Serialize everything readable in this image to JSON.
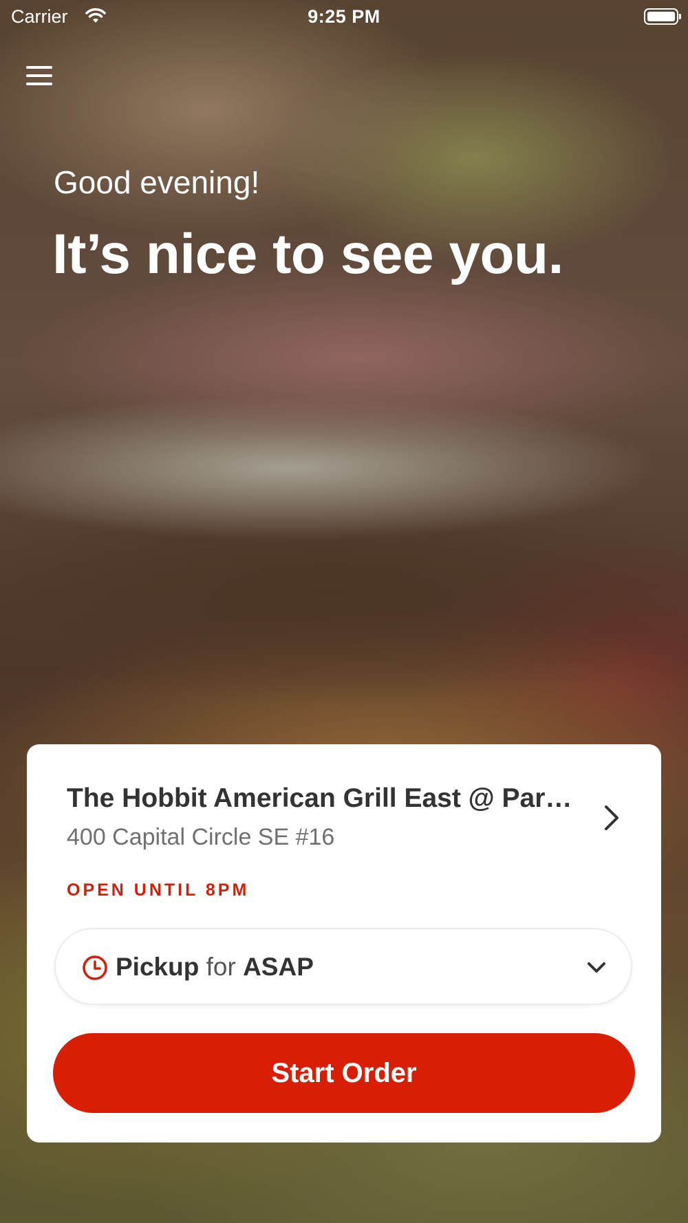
{
  "status_bar": {
    "carrier": "Carrier",
    "time": "9:25 PM"
  },
  "hero": {
    "greeting": "Good evening!",
    "headline": "It’s nice to see you."
  },
  "store": {
    "name": "The Hobbit American Grill East @ Park...",
    "address": "400 Capital Circle SE #16",
    "status": "OPEN UNTIL 8PM"
  },
  "order_options": {
    "mode": "Pickup",
    "connector": "for",
    "when": "ASAP"
  },
  "actions": {
    "start_order": "Start Order"
  },
  "colors": {
    "brand_red": "#d81e05",
    "status_red": "#d11f0c",
    "card_bg": "#ffffff"
  },
  "icons": {
    "menu": "hamburger-icon",
    "store_chevron": "chevron-right-icon",
    "time": "clock-icon",
    "dropdown": "chevron-down-icon"
  }
}
